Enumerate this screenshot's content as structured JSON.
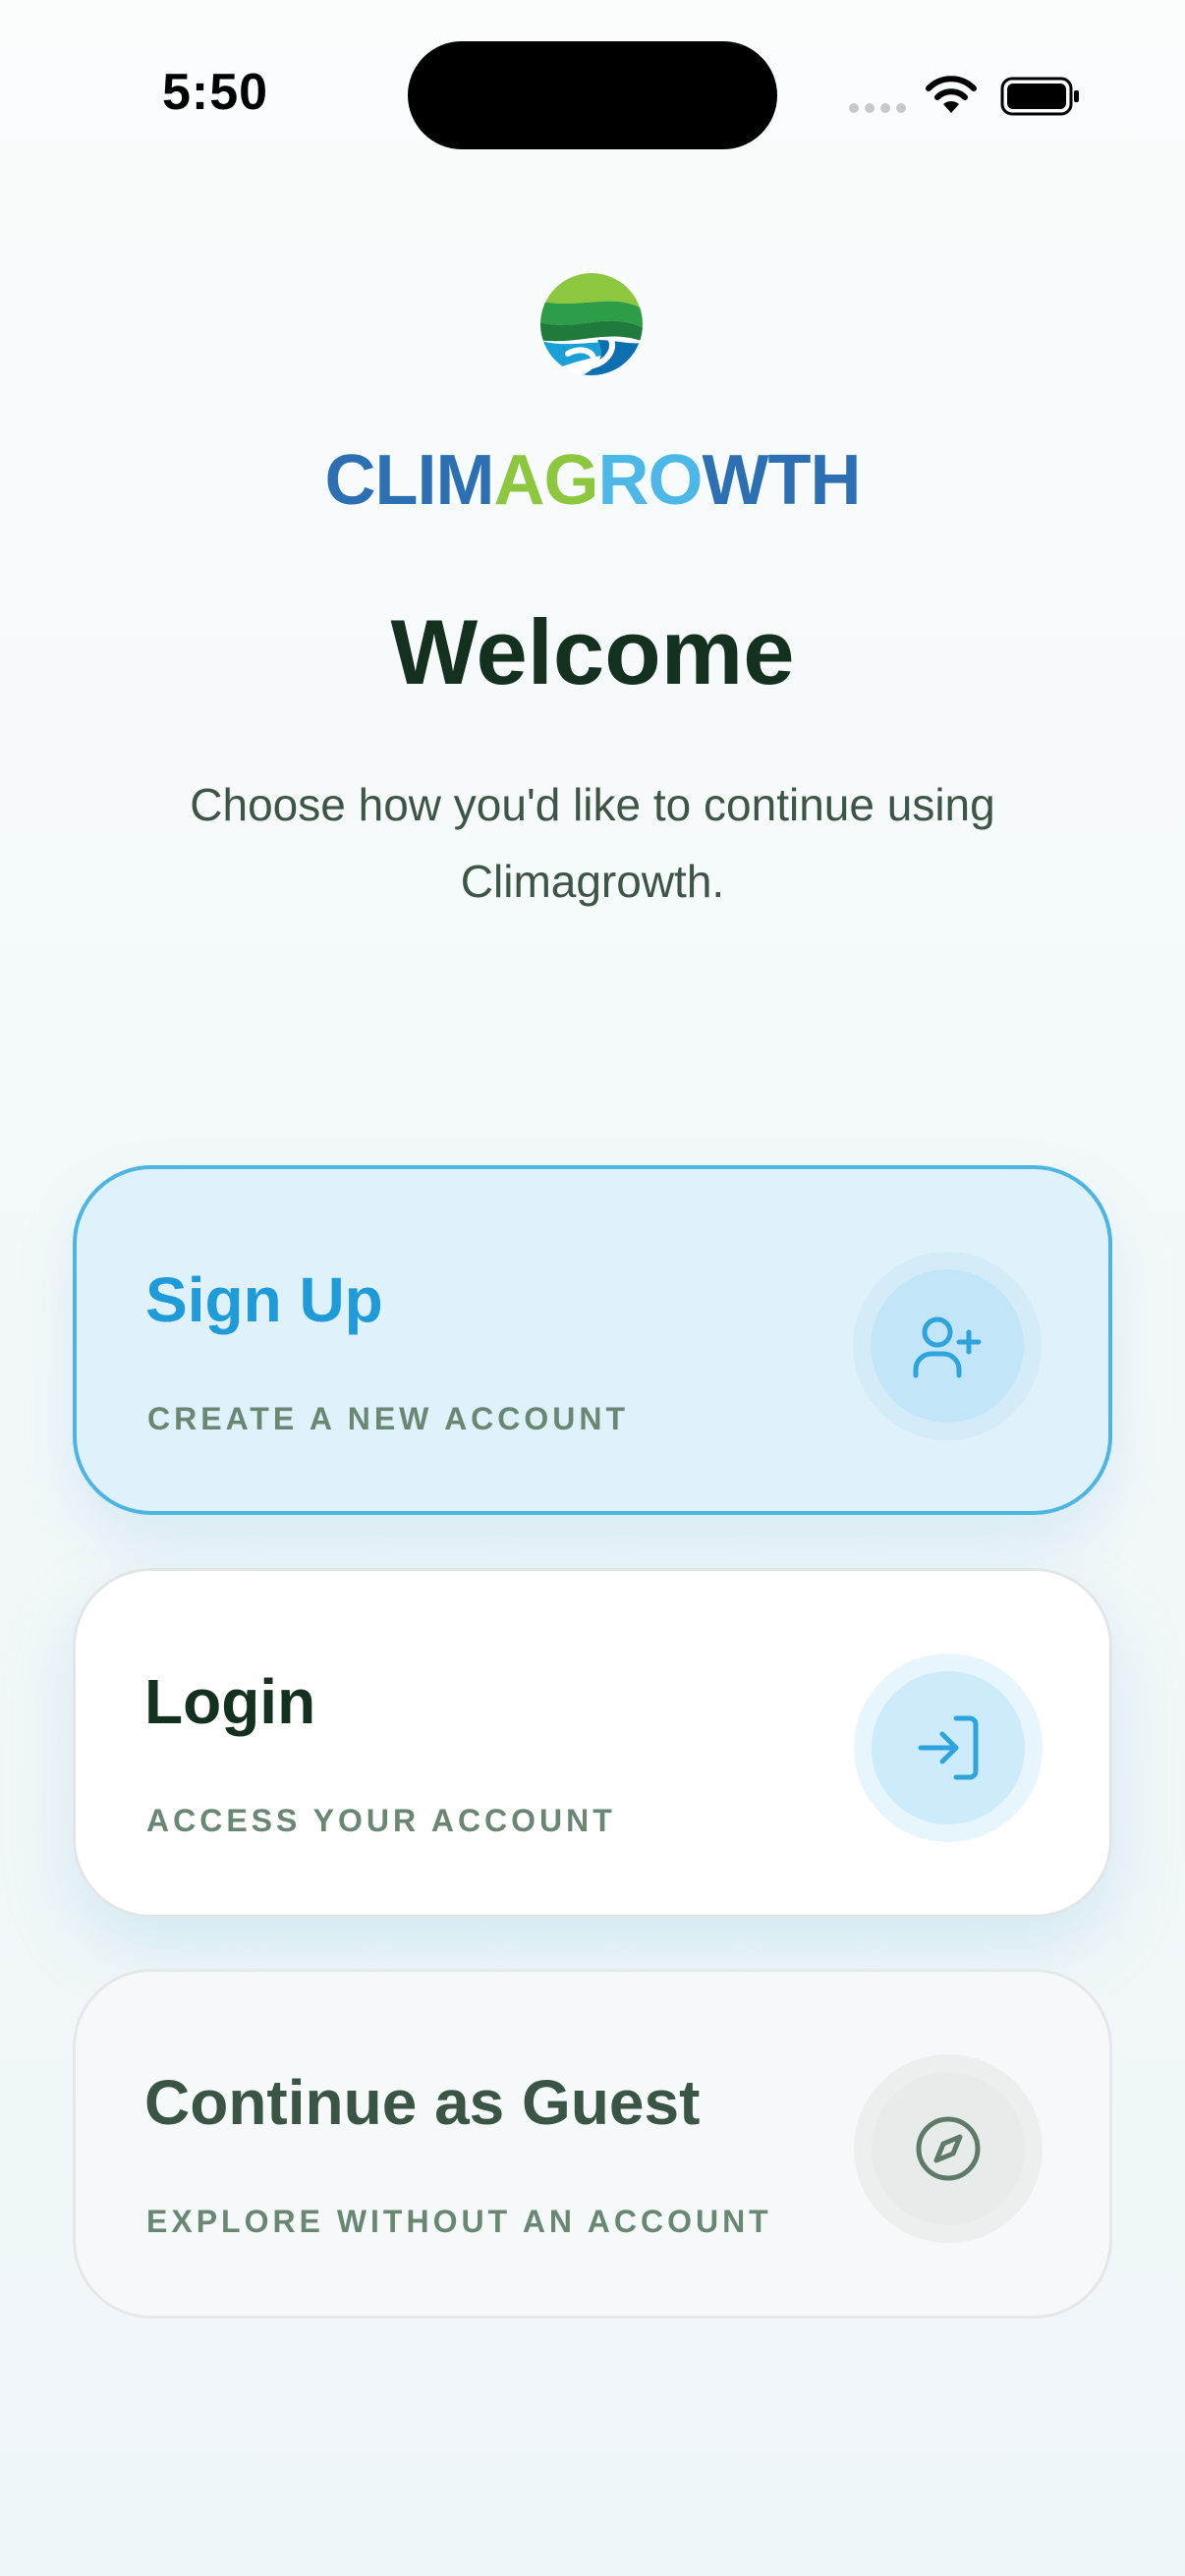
{
  "status_bar": {
    "time": "5:50"
  },
  "brand": {
    "parts": [
      {
        "text": "CLIM",
        "color": "#2d6fb3"
      },
      {
        "text": "AG",
        "color": "#8dc63f"
      },
      {
        "text": "RO",
        "color": "#4db8e8"
      },
      {
        "text": "WTH",
        "color": "#2d6fb3"
      }
    ]
  },
  "heading": "Welcome",
  "subtitle": "Choose how you'd like to continue using Climagrowth.",
  "options": [
    {
      "title": "Sign Up",
      "subtitle": "CREATE A NEW ACCOUNT",
      "icon": "user-plus-icon"
    },
    {
      "title": "Login",
      "subtitle": "ACCESS YOUR ACCOUNT",
      "icon": "login-icon"
    },
    {
      "title": "Continue as Guest",
      "subtitle": "EXPLORE WITHOUT AN ACCOUNT",
      "icon": "compass-icon"
    }
  ],
  "colors": {
    "accent": "#1e9bd8",
    "heading": "#14301f",
    "muted": "#6a8774"
  }
}
